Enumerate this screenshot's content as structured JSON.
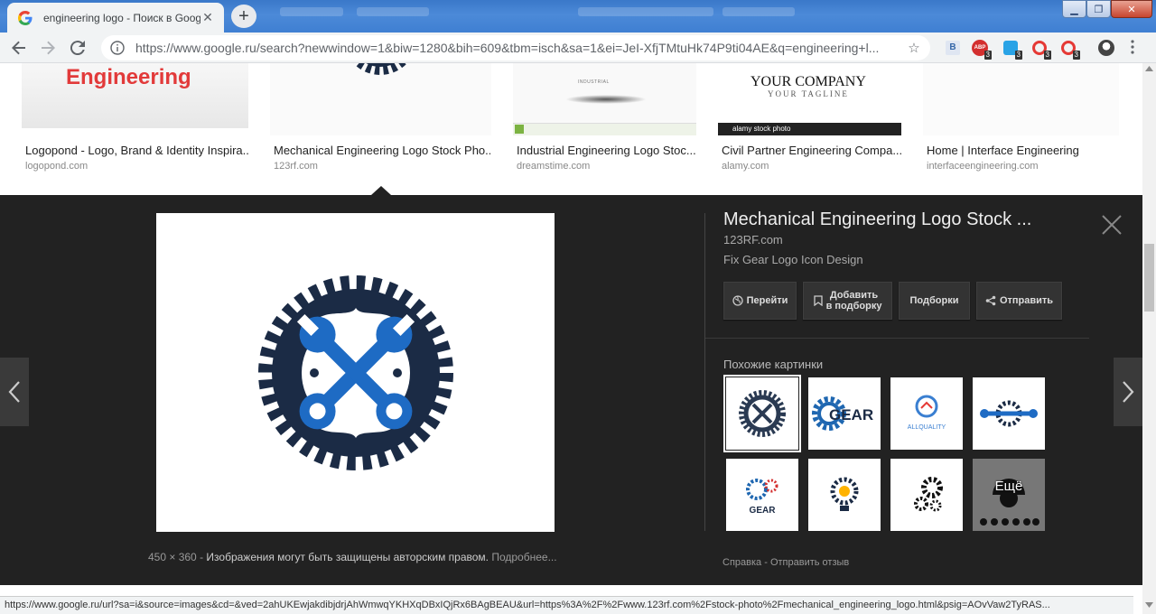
{
  "browser": {
    "tab_title": "engineering logo - Поиск в Goog",
    "tab_close": "✕",
    "new_tab": "+",
    "url": "https://www.google.ru/search?newwindow=1&biw=1280&bih=609&tbm=isch&sa=1&ei=JeI-XfjTMtuHk74P9ti04AE&q=engineering+l...",
    "window_controls": {
      "minimize": "▁",
      "maximize": "❐",
      "close": "✕"
    },
    "extensions": [
      {
        "name": "b-icon",
        "label": "B",
        "badge": ""
      },
      {
        "name": "adblock-icon",
        "label": "ABP",
        "badge": "3"
      },
      {
        "name": "blue-ext-icon",
        "label": "",
        "badge": "3"
      },
      {
        "name": "red-ext-icon-1",
        "label": "",
        "badge": "3"
      },
      {
        "name": "red-ext-icon-2",
        "label": "",
        "badge": "3"
      }
    ]
  },
  "results": [
    {
      "title": "Logopond - Logo, Brand & Identity Inspira...",
      "source": "logopond.com",
      "thumb_text": "Engineering"
    },
    {
      "title": "Mechanical Engineering Logo Stock Pho...",
      "source": "123rf.com"
    },
    {
      "title": "Industrial Engineering Logo Stoc...",
      "source": "dreamstime.com",
      "thumb_text": "INDUSTRIAL"
    },
    {
      "title": "Civil Partner Engineering Compa...",
      "source": "alamy.com",
      "thumb_text": "YOUR COMPANY",
      "thumb_sub": "YOUR TAGLINE",
      "thumb_bar": "alamy stock photo"
    },
    {
      "title": "Home | Interface Engineering",
      "source": "interfaceengineering.com"
    }
  ],
  "panel": {
    "title": "Mechanical Engineering Logo Stock ...",
    "source": "123RF.com",
    "description": "Fix Gear Logo Icon Design",
    "buttons": {
      "visit": "Перейти",
      "save_line1": "Добавить",
      "save_line2": "в подборку",
      "collections": "Подборки",
      "share": "Отправить"
    },
    "size": "450 × 360",
    "copyright": "Изображения могут быть защищены авторским правом.",
    "more_info": "Подробнее...",
    "similar_label": "Похожие картинки",
    "more_label": "Ещё",
    "similar_texts": {
      "gear1": "GEAR",
      "allquality": "ALLQUALITY",
      "gear2": "GEAR"
    },
    "help": "Справка",
    "feedback": "Отправить отзыв",
    "dash": "-"
  },
  "status_url": "https://www.google.ru/url?sa=i&source=images&cd=&ved=2ahUKEwjakdibjdrjAhWmwqYKHXqDBxIQjRx6BAgBEAU&url=https%3A%2F%2Fwww.123rf.com%2Fstock-photo%2Fmechanical_engineering_logo.html&psig=AOvVaw2TyRAS...",
  "colors": {
    "panel_bg": "#222222",
    "logo_navy": "#1b2b45",
    "logo_blue": "#1e6bc4",
    "accent_red": "#e53935"
  }
}
